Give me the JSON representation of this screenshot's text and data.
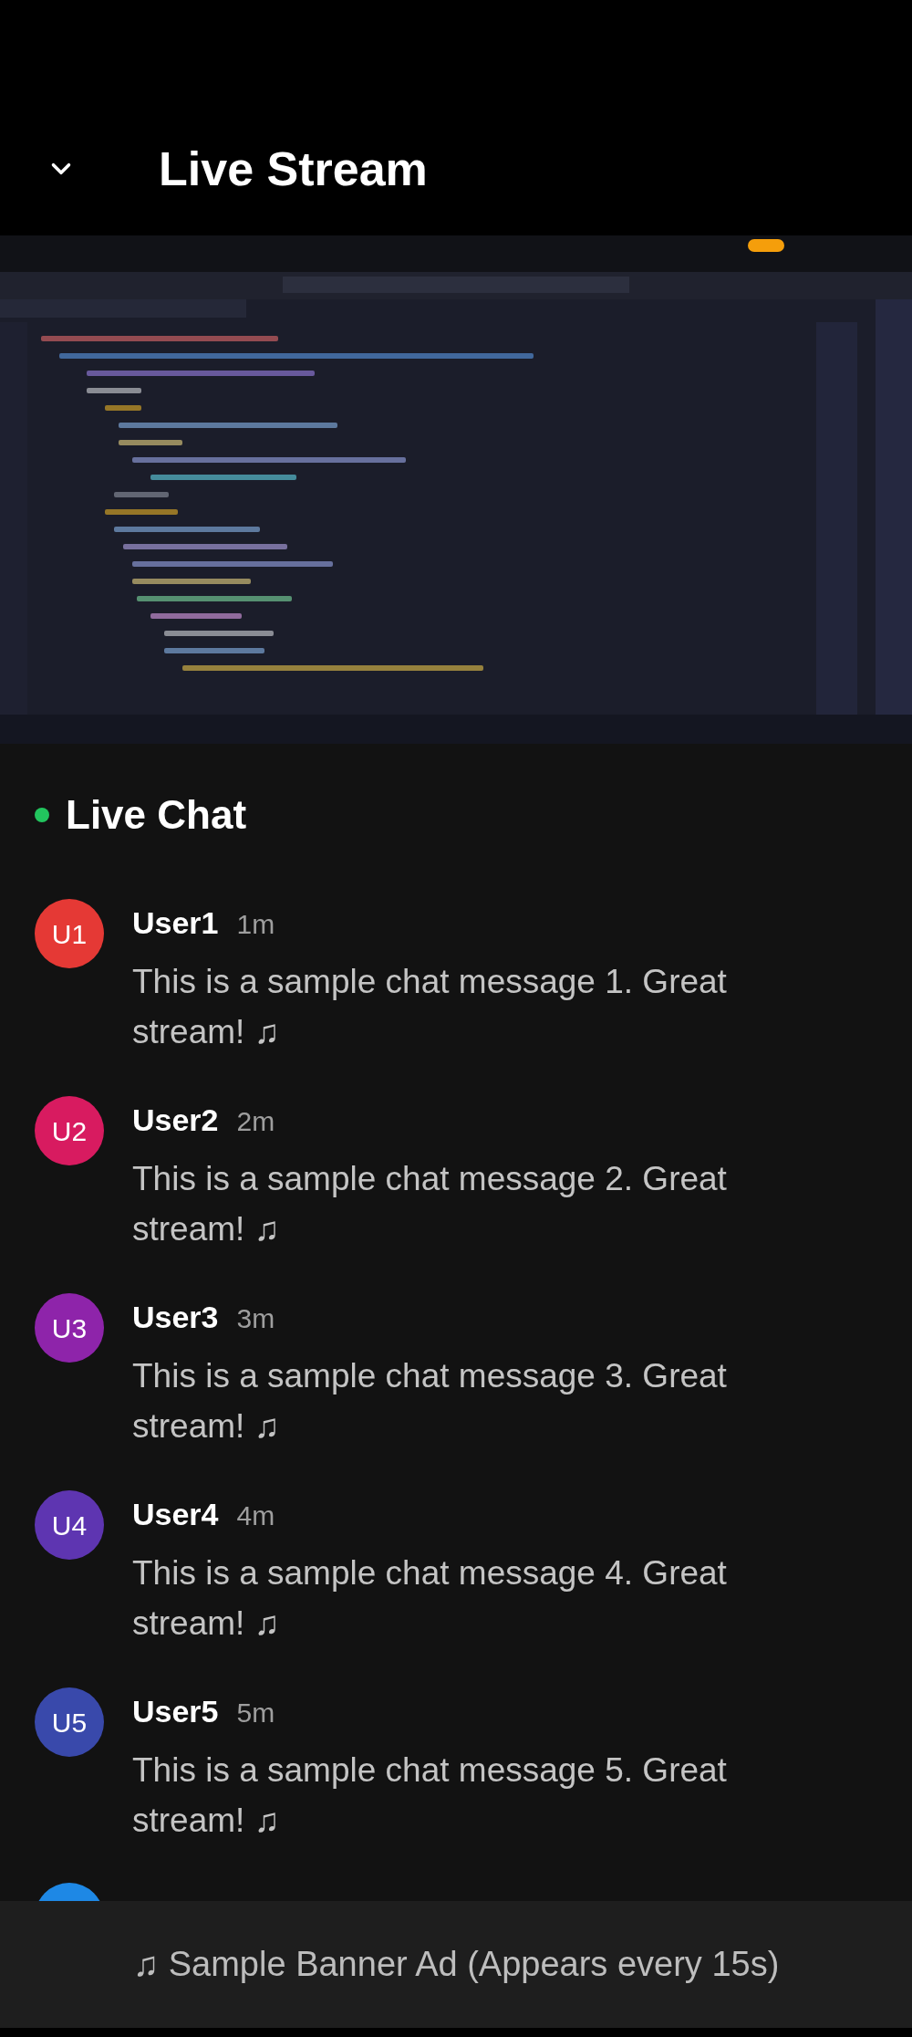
{
  "header": {
    "title": "Live Stream"
  },
  "chat": {
    "title": "Live Chat",
    "live_indicator": {
      "color": "#22c55e"
    },
    "messages": [
      {
        "initials": "U1",
        "user": "User1",
        "time": "1m",
        "text": "This is a sample chat message 1. Great stream! ♫",
        "color": "#e53935"
      },
      {
        "initials": "U2",
        "user": "User2",
        "time": "2m",
        "text": "This is a sample chat message 2. Great stream! ♫",
        "color": "#d81b60"
      },
      {
        "initials": "U3",
        "user": "User3",
        "time": "3m",
        "text": "This is a sample chat message 3. Great stream! ♫",
        "color": "#8e24aa"
      },
      {
        "initials": "U4",
        "user": "User4",
        "time": "4m",
        "text": "This is a sample chat message 4. Great stream! ♫",
        "color": "#5e35b1"
      },
      {
        "initials": "U5",
        "user": "User5",
        "time": "5m",
        "text": "This is a sample chat message 5. Great stream! ♫",
        "color": "#3949ab"
      }
    ],
    "partial_avatar": {
      "color": "#1e88e5"
    }
  },
  "banner": {
    "text": "♫ Sample Banner Ad (Appears every 15s)"
  }
}
